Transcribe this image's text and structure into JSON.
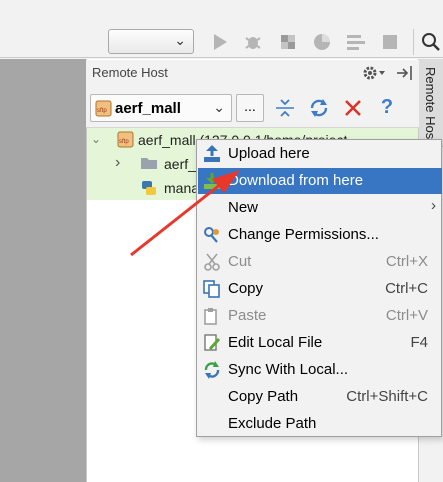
{
  "toolbar": {
    "run_config_value": "",
    "icons": [
      "run-icon",
      "debug-icon",
      "coverage-icon",
      "profile-icon",
      "build-icon",
      "stop-icon",
      "search-icon"
    ]
  },
  "panel": {
    "title": "Remote Host",
    "side_tab": "Remote Host",
    "host_name": "aerf_mall",
    "more_button": "..."
  },
  "tree": {
    "root_label": "aerf_mall (127.0.0.1/home/project",
    "child_folder": "aerf_",
    "child_file": "mana"
  },
  "menu": {
    "items": [
      {
        "label": "Upload here",
        "shortcut": "",
        "icon": "upload-icon"
      },
      {
        "label": "Download from here",
        "shortcut": "",
        "icon": "download-icon"
      },
      {
        "label": "New",
        "shortcut": "",
        "icon": ""
      },
      {
        "label": "Change Permissions...",
        "shortcut": "",
        "icon": "permissions-icon"
      },
      {
        "label": "Cut",
        "shortcut": "Ctrl+X",
        "icon": "scissors-icon"
      },
      {
        "label": "Copy",
        "shortcut": "Ctrl+C",
        "icon": "copy-icon"
      },
      {
        "label": "Paste",
        "shortcut": "Ctrl+V",
        "icon": "paste-icon"
      },
      {
        "label": "Edit Local File",
        "shortcut": "F4",
        "icon": "edit-file-icon"
      },
      {
        "label": "Sync With Local...",
        "shortcut": "",
        "icon": "sync-icon"
      },
      {
        "label": "Copy Path",
        "shortcut": "Ctrl+Shift+C",
        "icon": ""
      },
      {
        "label": "Exclude Path",
        "shortcut": "",
        "icon": ""
      }
    ]
  },
  "colors": {
    "menu_highlight": "#3876c4",
    "tree_selection": "#e4f6d7",
    "annotation_arrow": "#e8382c"
  }
}
